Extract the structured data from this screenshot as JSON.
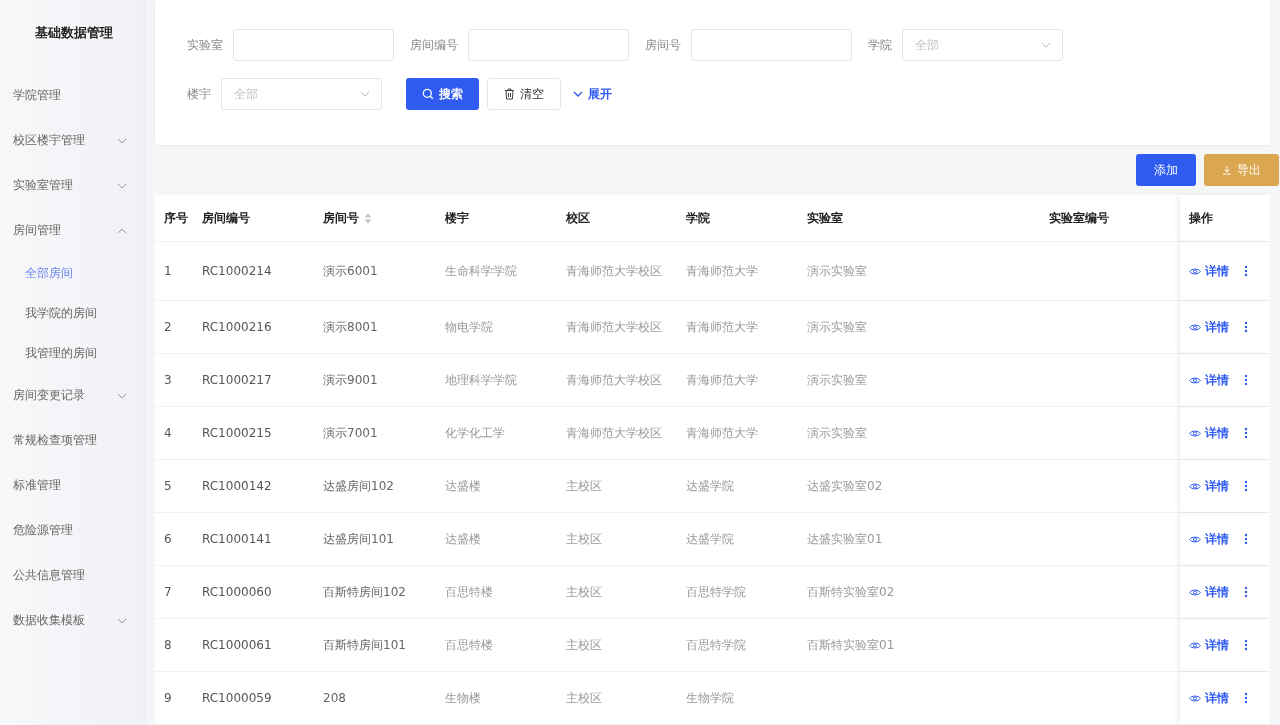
{
  "sidebar": {
    "title": "基础数据管理",
    "items": [
      {
        "label": "学院管理",
        "kind": "link",
        "selected": false
      },
      {
        "label": "校区楼宇管理",
        "kind": "group",
        "expanded": false,
        "selected": false
      },
      {
        "label": "实验室管理",
        "kind": "group",
        "expanded": false,
        "selected": false
      },
      {
        "label": "房间管理",
        "kind": "group",
        "expanded": true,
        "selected": false,
        "children": [
          {
            "label": "全部房间",
            "selected": true
          },
          {
            "label": "我学院的房间",
            "selected": false
          },
          {
            "label": "我管理的房间",
            "selected": false
          }
        ]
      },
      {
        "label": "房间变更记录",
        "kind": "group",
        "expanded": false,
        "selected": false
      },
      {
        "label": "常规检查项管理",
        "kind": "link",
        "selected": false
      },
      {
        "label": "标准管理",
        "kind": "link",
        "selected": false
      },
      {
        "label": "危险源管理",
        "kind": "link",
        "selected": false
      },
      {
        "label": "公共信息管理",
        "kind": "link",
        "selected": false
      },
      {
        "label": "数据收集模板",
        "kind": "group",
        "expanded": false,
        "selected": false
      }
    ]
  },
  "filters": [
    {
      "label": "实验室",
      "kind": "input"
    },
    {
      "label": "房间编号",
      "kind": "input"
    },
    {
      "label": "房间号",
      "kind": "input"
    },
    {
      "label": "学院",
      "kind": "select",
      "placeholder": "全部"
    },
    {
      "label": "楼宇",
      "kind": "select",
      "placeholder": "全部"
    }
  ],
  "filter_actions": {
    "search": "搜索",
    "clear": "清空",
    "expand": "展开"
  },
  "toolbar": {
    "add": "添加",
    "export": "导出"
  },
  "table": {
    "columns": [
      {
        "label": "序号",
        "sortable": false
      },
      {
        "label": "房间编号",
        "sortable": false
      },
      {
        "label": "房间号",
        "sortable": true
      },
      {
        "label": "楼宇",
        "sortable": false
      },
      {
        "label": "校区",
        "sortable": false
      },
      {
        "label": "学院",
        "sortable": false
      },
      {
        "label": "实验室",
        "sortable": false
      },
      {
        "label": "实验室编号",
        "sortable": false
      },
      {
        "label": "操作",
        "sortable": false
      }
    ],
    "rows": [
      {
        "cells": [
          "1",
          "RC1000214",
          "演示6001",
          "生命科学学院",
          "青海师范大学校区",
          "青海师范大学",
          "演示实验室",
          ""
        ],
        "action": "详情"
      },
      {
        "cells": [
          "2",
          "RC1000216",
          "演示8001",
          "物电学院",
          "青海师范大学校区",
          "青海师范大学",
          "演示实验室",
          ""
        ],
        "action": "详情"
      },
      {
        "cells": [
          "3",
          "RC1000217",
          "演示9001",
          "地理科学学院",
          "青海师范大学校区",
          "青海师范大学",
          "演示实验室",
          ""
        ],
        "action": "详情"
      },
      {
        "cells": [
          "4",
          "RC1000215",
          "演示7001",
          "化学化工学",
          "青海师范大学校区",
          "青海师范大学",
          "演示实验室",
          ""
        ],
        "action": "详情"
      },
      {
        "cells": [
          "5",
          "RC1000142",
          "达盛房间102",
          "达盛楼",
          "主校区",
          "达盛学院",
          "达盛实验室02",
          ""
        ],
        "action": "详情"
      },
      {
        "cells": [
          "6",
          "RC1000141",
          "达盛房间101",
          "达盛楼",
          "主校区",
          "达盛学院",
          "达盛实验室01",
          ""
        ],
        "action": "详情"
      },
      {
        "cells": [
          "7",
          "RC1000060",
          "百斯特房间102",
          "百思特楼",
          "主校区",
          "百思特学院",
          "百斯特实验室02",
          ""
        ],
        "action": "详情"
      },
      {
        "cells": [
          "8",
          "RC1000061",
          "百斯特房间101",
          "百思特楼",
          "主校区",
          "百思特学院",
          "百斯特实验室01",
          ""
        ],
        "action": "详情"
      },
      {
        "cells": [
          "9",
          "RC1000059",
          "208",
          "生物楼",
          "主校区",
          "生物学院",
          "",
          ""
        ],
        "action": "详情"
      }
    ]
  }
}
